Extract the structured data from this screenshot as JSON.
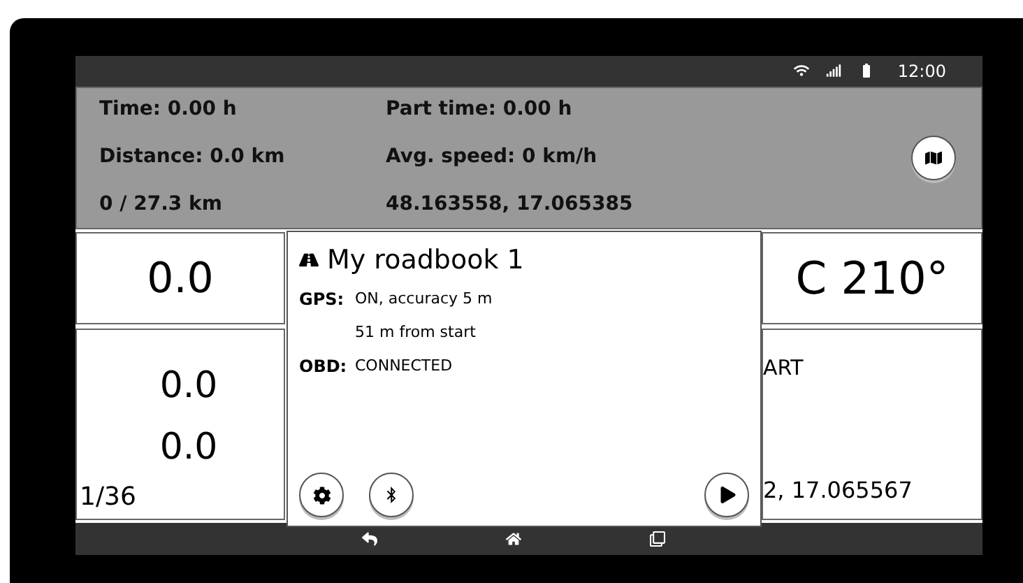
{
  "status_bar": {
    "time": "12:00"
  },
  "stats": [
    "Time: 0.00 h",
    "Part time: 0.00 h",
    "Distance: 0.0 km",
    "Avg. speed: 0 km/h",
    "0 / 27.3 km",
    "48.163558, 17.065385"
  ],
  "speed_box": {
    "value": "0.0"
  },
  "heading_box": {
    "value": "C 210°"
  },
  "left_panel": {
    "values": [
      "0.0",
      "0.0"
    ],
    "counter": "1/36"
  },
  "right_panel": {
    "status": "ART",
    "coordinates": "2, 17.065567"
  },
  "dialog": {
    "title": "My roadbook 1",
    "rows": [
      {
        "label": "GPS:",
        "lines": [
          "ON, accuracy 5 m",
          "51 m from start"
        ]
      },
      {
        "label": "OBD:",
        "lines": [
          "CONNECTED"
        ]
      }
    ]
  }
}
